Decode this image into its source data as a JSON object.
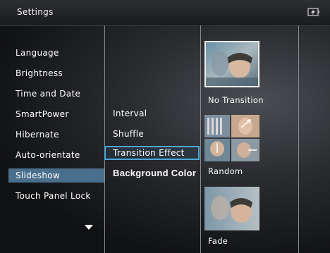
{
  "header": {
    "title": "Settings",
    "battery_icon": "battery-charging-icon"
  },
  "menu": {
    "items": [
      {
        "label": "Language"
      },
      {
        "label": "Brightness"
      },
      {
        "label": "Time and Date"
      },
      {
        "label": "SmartPower"
      },
      {
        "label": "Hibernate"
      },
      {
        "label": "Auto-orientate"
      },
      {
        "label": "Slideshow",
        "selected": true
      },
      {
        "label": "Touch Panel Lock"
      }
    ],
    "scroll_icon": "triangle-down-icon"
  },
  "options": {
    "items": [
      {
        "label": "Interval"
      },
      {
        "label": "Shuffle"
      },
      {
        "label": "Transition Effect",
        "focused": true
      },
      {
        "label": "Background Color"
      }
    ]
  },
  "transitions": {
    "items": [
      {
        "label": "No Transition",
        "icon": "photo-thumbnail-icon"
      },
      {
        "label": "Random",
        "icon": "random-collage-thumbnail-icon"
      },
      {
        "label": "Fade",
        "icon": "fade-thumbnail-icon"
      }
    ]
  },
  "colors": {
    "selection": "#4a6f8c",
    "focus_border": "#4ea8d8"
  }
}
